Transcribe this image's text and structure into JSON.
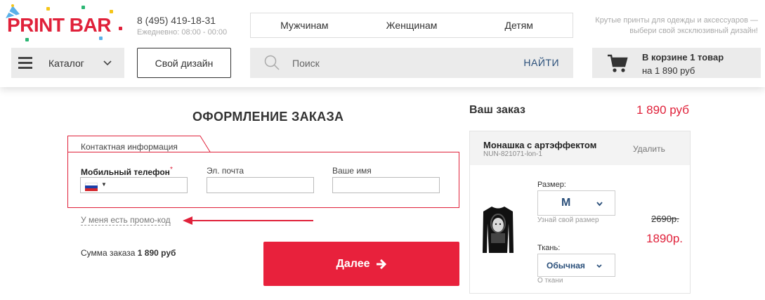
{
  "logo": {
    "text": "PRINT BAR"
  },
  "contacts": {
    "phone": "8 (495) 419-18-31",
    "hours": "Ежедневно: 08:00 - 00:00"
  },
  "nav": {
    "items": [
      "Мужчинам",
      "Женщинам",
      "Детям"
    ]
  },
  "tagline": {
    "line1": "Крутые принты для одежды и аксессуаров —",
    "line2": "выбери свой эксклюзивный дизайн!"
  },
  "catalog": {
    "label": "Каталог"
  },
  "own_design": {
    "label": "Свой дизайн"
  },
  "search": {
    "placeholder": "Поиск",
    "button": "НАЙТИ"
  },
  "cart": {
    "title": "В корзине 1 товар",
    "sum": "на 1 890 руб"
  },
  "order": {
    "title": "ОФОРМЛЕНИЕ ЗАКАЗА",
    "contact_tab": "Контактная информация",
    "phone_label": "Мобильный телефон",
    "required_mark": "*",
    "email_label": "Эл. почта",
    "name_label": "Ваше имя",
    "promo_link": "У меня есть промо-код",
    "sum_label": "Сумма заказа",
    "sum_value": "1 890 руб",
    "next_button": "Далее",
    "next_icon": "arrow-right-icon"
  },
  "summary": {
    "title": "Ваш заказ",
    "total": "1 890 руб",
    "product": {
      "name": "Монашка с артэффектом",
      "sku": "NUN-821071-lon-1",
      "delete": "Удалить",
      "size_label": "Размер:",
      "size_value": "M",
      "size_hint": "Узнай свой размер",
      "fabric_label": "Ткань:",
      "fabric_value": "Обычная",
      "fabric_hint": "О ткани",
      "old_price": "2690р.",
      "price": "1890р."
    }
  },
  "colors": {
    "accent": "#e0213a",
    "link": "#2a4f7a",
    "panel": "#ebebeb"
  }
}
